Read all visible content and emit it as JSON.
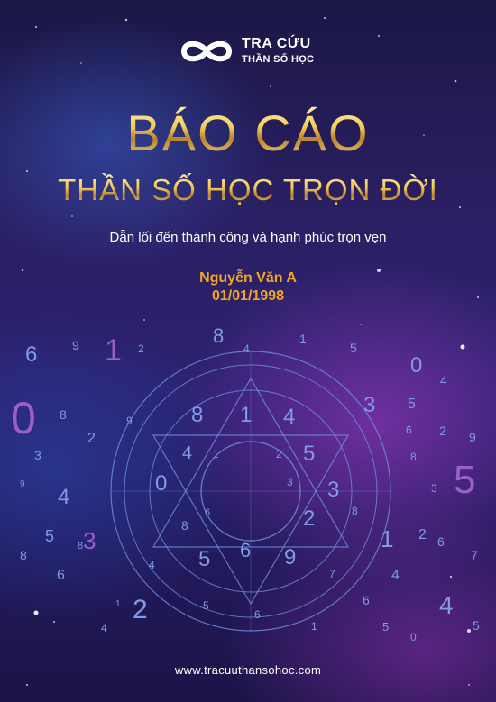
{
  "logo": {
    "icon": "infinity-icon",
    "line1": "TRA CỨU",
    "line2": "THẦN SỐ HỌC"
  },
  "title": "BÁO CÁO",
  "subtitle": "THẦN SỐ HỌC TRỌN ĐỜI",
  "tagline": "Dẫn lối đến thành công và hạnh phúc trọn vẹn",
  "person": {
    "name": "Nguyễn Văn A",
    "dob": "01/01/1998"
  },
  "website": "www.tracuuthansohoc.com",
  "decorative_numbers": [
    "6",
    "9",
    "1",
    "2",
    "0",
    "8",
    "2",
    "3",
    "4",
    "5",
    "3",
    "8",
    "9",
    "8",
    "6",
    "2",
    "1",
    "4",
    "8",
    "1",
    "4",
    "5",
    "0",
    "4",
    "3",
    "5",
    "2",
    "6",
    "9",
    "8",
    "5",
    "3",
    "1",
    "2",
    "6",
    "7",
    "4",
    "4",
    "6",
    "1",
    "5",
    "0",
    "5",
    "3",
    "8",
    "0",
    "5",
    "8",
    "6",
    "6",
    "1",
    "4",
    "2",
    "5",
    "1",
    "2",
    "8",
    "1",
    "8",
    "2",
    "1"
  ],
  "wheel_numbers": [
    "8",
    "1",
    "4",
    "5",
    "3",
    "2",
    "9",
    "6",
    "5",
    "8",
    "6",
    "0",
    "4",
    "1",
    "2",
    "3",
    "4",
    "5",
    "6",
    "7",
    "8",
    "9"
  ],
  "colors": {
    "accent_gold": "#e7b946",
    "name_orange": "#f2a51e",
    "background": "#2a1f63",
    "number_blue": "#7f9be6"
  }
}
